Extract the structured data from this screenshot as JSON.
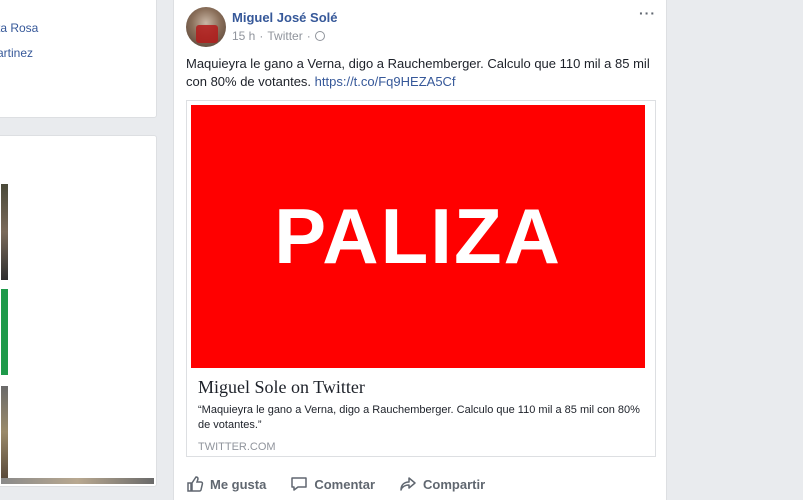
{
  "left": {
    "links": [
      "ta Rosa",
      "artinez"
    ]
  },
  "post": {
    "author": "Miguel José Solé",
    "time": "15 h",
    "separator": "·",
    "source": "Twitter",
    "text": "Maquieyra le gano a Verna, digo a Rauchemberger. Calculo que 110 mil a 85 mil con 80% de votantes.",
    "link": "https://t.co/Fq9HEZA5Cf",
    "more_label": "···",
    "card": {
      "image_text": "PALIZA",
      "image_color": "#ff0000",
      "title": "Miguel Sole on Twitter",
      "description": "“Maquieyra le gano a Verna, digo a Rauchemberger. Calculo que 110 mil a 85 mil con 80% de votantes.”",
      "domain": "TWITTER.COM"
    },
    "actions": {
      "like": "Me gusta",
      "comment": "Comentar",
      "share": "Compartir"
    }
  }
}
